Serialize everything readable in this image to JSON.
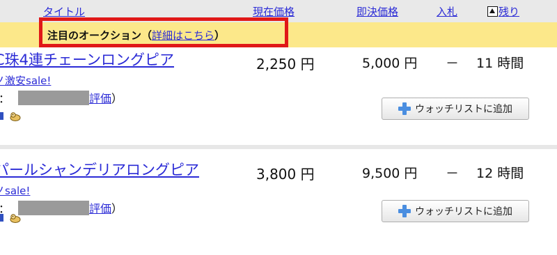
{
  "header": {
    "title": "タイトル",
    "current_price": "現在価格",
    "buyout_price": "即決価格",
    "bids": "入札",
    "remaining": "残り"
  },
  "featured": {
    "label": "注目のオークション",
    "paren_open": "（",
    "link": "詳細はこちら",
    "paren_close": "）"
  },
  "items": [
    {
      "title_line1": "C珠4連チェーンロングピア",
      "title_line2": "ノ激安sale!",
      "rating_link": "評価",
      "rating_paren": "）",
      "current_price": "2,250 円",
      "buyout_price": "5,000 円",
      "bids": "－",
      "remaining": "11 時間",
      "watch_label": "ウォッチリストに追加"
    },
    {
      "title_line1": "パールシャンデリアロングピア",
      "title_line2": "ノsale!",
      "rating_link": "評価",
      "rating_paren": "）",
      "current_price": "3,800 円",
      "buyout_price": "9,500 円",
      "bids": "－",
      "remaining": "12 時間",
      "watch_label": "ウォッチリストに追加"
    }
  ],
  "icons": {
    "sort": "sort-ascending-icon",
    "watch": "plus-icon",
    "mascot": "mascot-icon"
  },
  "colors": {
    "link": "#2b2bd6",
    "featured_bg": "#fce88a",
    "highlight_border": "#e01818",
    "header_bg": "#e9e9e9",
    "plus": "#4a8ee0"
  }
}
